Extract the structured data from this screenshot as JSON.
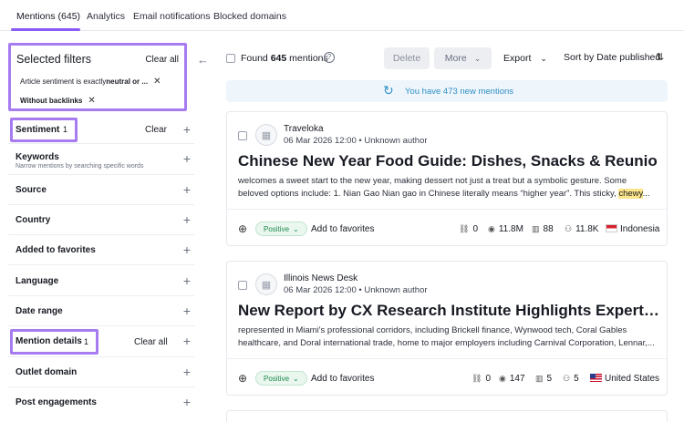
{
  "tabs": [
    {
      "label": "Mentions (645)"
    },
    {
      "label": "Analytics"
    },
    {
      "label": "Email notifications"
    },
    {
      "label": "Blocked domains"
    }
  ],
  "filters": {
    "title": "Selected filters",
    "clear_all": "Clear all",
    "chip1_prefix": "Article sentiment is exactly ",
    "chip1_bold": "neutral or ...",
    "chip2": "Without backlinks"
  },
  "sidebar": {
    "sentiment": {
      "label": "Sentiment",
      "badge": "1",
      "clear": "Clear"
    },
    "keywords": {
      "label": "Keywords",
      "sub": "Narrow mentions by searching specific words"
    },
    "source": {
      "label": "Source"
    },
    "country": {
      "label": "Country"
    },
    "favorites": {
      "label": "Added to favorites"
    },
    "language": {
      "label": "Language"
    },
    "date_range": {
      "label": "Date range"
    },
    "mention_details": {
      "label": "Mention details",
      "badge": "1",
      "clear": "Clear all"
    },
    "outlet_domain": {
      "label": "Outlet domain"
    },
    "post_engagements": {
      "label": "Post engagements"
    }
  },
  "toolbar": {
    "found_prefix": "Found",
    "found_count": "645",
    "found_suffix": "mentions",
    "delete": "Delete",
    "more": "More",
    "export": "Export",
    "sort": "Sort by Date published"
  },
  "banner": {
    "text": "You have 473 new mentions"
  },
  "mentions": [
    {
      "source": "Traveloka",
      "meta": "06 Mar 2026 12:00 • Unknown author",
      "title": "Chinese New Year Food Guide: Dishes, Snacks & Reunion…",
      "snippet_a": "welcomes a sweet start to the new year, making dessert not just a treat but a symbolic gesture. Some beloved options include: 1. Nian Gao Nian gao in Chinese literally means “higher year”. This sticky, ",
      "snippet_mark": "chewy",
      "snippet_b": "...",
      "sentiment": "Positive",
      "favorite": "Add to favorites",
      "links": "0",
      "reach": "11.8M",
      "engagement": "88",
      "visits": "11.8K",
      "country": "Indonesia",
      "flag": "id"
    },
    {
      "source": "Illinois News Desk",
      "meta": "06 Mar 2026 12:00 • Unknown author",
      "title": "New Report by CX Research Institute Highlights Expert…",
      "snippet_a": "represented in Miami's professional corridors, including Brickell finance, Wynwood tech, Coral Gables healthcare, and Doral international trade, home to major employers including Carnival Corporation, Lennar,...",
      "snippet_mark": "",
      "snippet_b": "",
      "sentiment": "Positive",
      "favorite": "Add to favorites",
      "links": "0",
      "reach": "147",
      "engagement": "5",
      "visits": "5",
      "country": "United States",
      "flag": "us"
    }
  ],
  "colors": {
    "accent": "#8a5cf5",
    "highlight_border": "#a77cf0",
    "positive": "#1f8a4c",
    "banner": "#2f8fc7"
  }
}
